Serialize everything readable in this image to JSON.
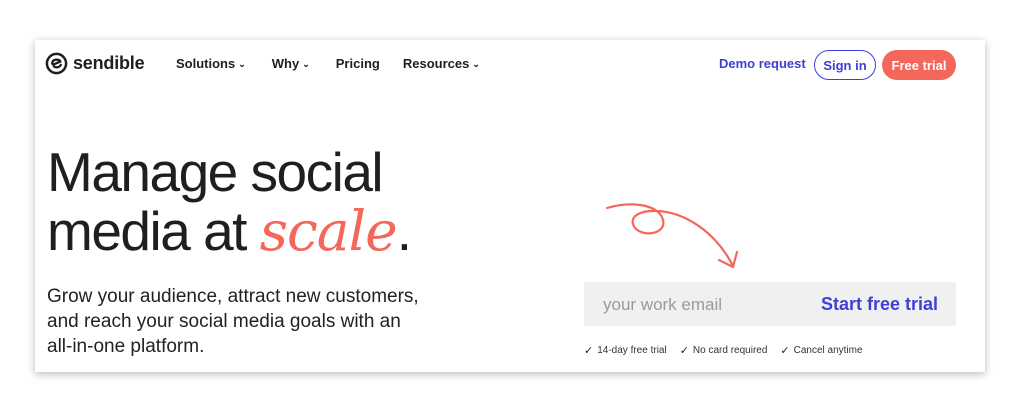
{
  "brand": {
    "name": "sendible"
  },
  "nav": {
    "items": [
      {
        "label": "Solutions",
        "has_dropdown": true
      },
      {
        "label": "Why",
        "has_dropdown": true
      },
      {
        "label": "Pricing",
        "has_dropdown": false
      },
      {
        "label": "Resources",
        "has_dropdown": true
      }
    ],
    "demo_label": "Demo request",
    "signin_label": "Sign in",
    "trial_label": "Free trial"
  },
  "hero": {
    "headline_line1": "Manage social",
    "headline_line2_prefix": "media at ",
    "headline_accent": "scale",
    "headline_suffix": ".",
    "subtext": "Grow your audience, attract new customers, and reach your social media goals with an all-in-one platform."
  },
  "signup": {
    "email_placeholder": "your work email",
    "cta_label": "Start free trial",
    "perks": [
      "14-day free trial",
      "No card required",
      "Cancel anytime"
    ]
  },
  "colors": {
    "accent": "#f4675a",
    "primary": "#3f3fd8",
    "text": "#1f1f1f"
  },
  "icons": {
    "logo": "sendible-logo-icon",
    "dropdown": "chevron-down-icon",
    "check": "check-icon",
    "arrow": "curly-arrow-icon"
  }
}
